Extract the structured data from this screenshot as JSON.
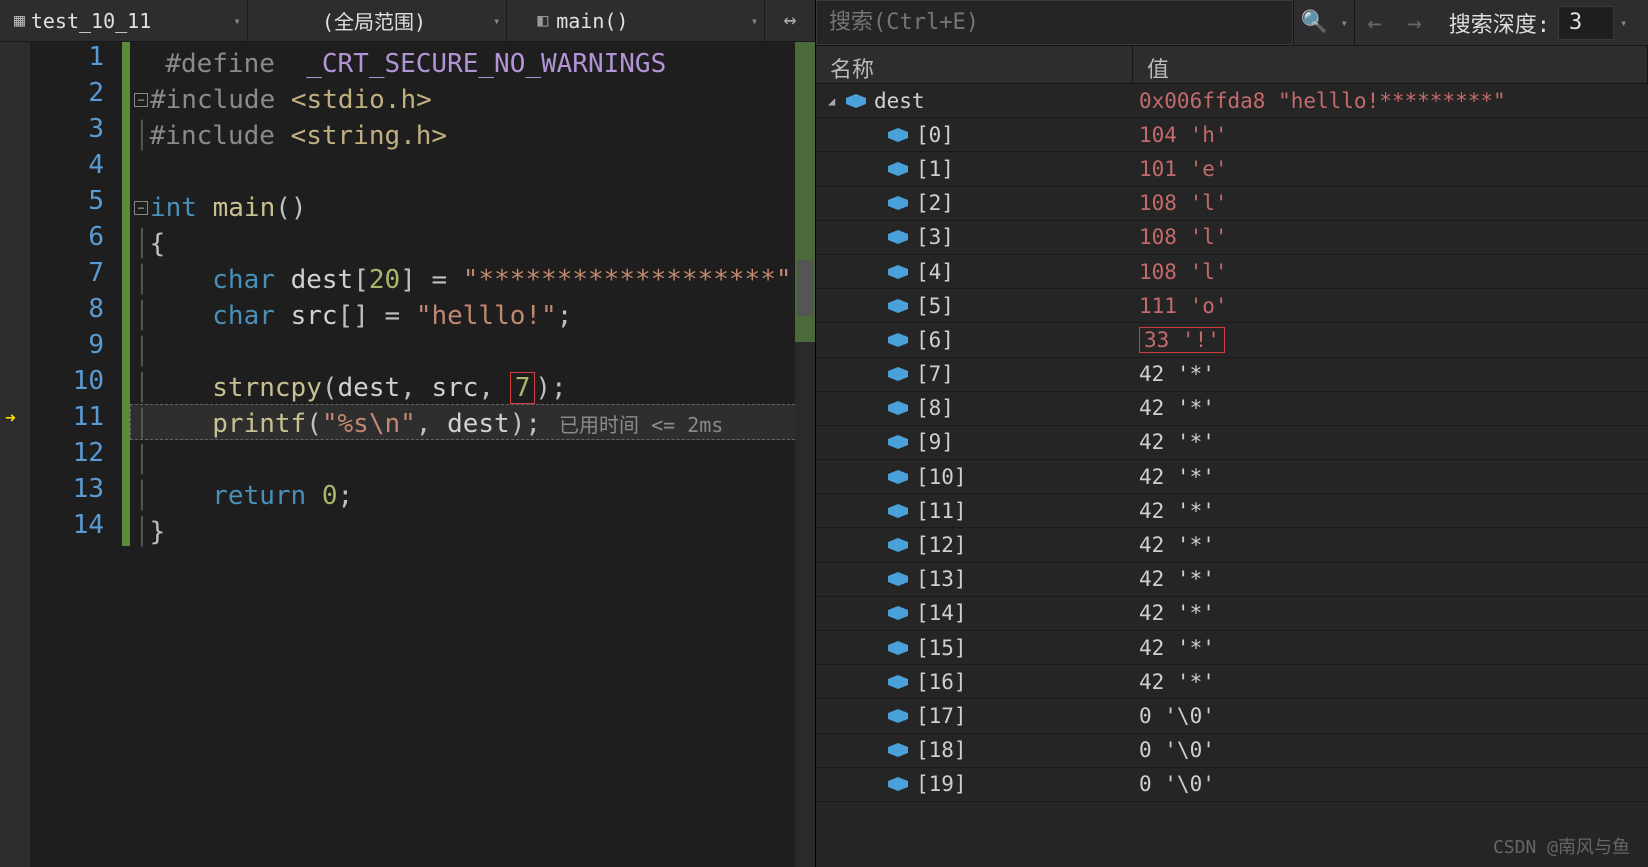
{
  "topbar": {
    "file": "test_10_11",
    "scope": "(全局范围)",
    "func": "main()"
  },
  "editor": {
    "lines": [
      "1",
      "2",
      "3",
      "4",
      "5",
      "6",
      "7",
      "8",
      "9",
      "10",
      "11",
      "12",
      "13",
      "14"
    ],
    "arrow_line": 11,
    "code": {
      "l1": {
        "pp": "#define",
        "mac": "_CRT_SECURE_NO_WARNINGS"
      },
      "l2": {
        "pp": "#include",
        "hdr": "<stdio.h>"
      },
      "l3": {
        "pp": "#include",
        "hdr": "<string.h>"
      },
      "l5": {
        "kw": "int",
        "fn": "main"
      },
      "l7": {
        "kw": "char",
        "id": "dest",
        "sz": "20",
        "str": "\"*******************\""
      },
      "l8": {
        "kw": "char",
        "id": "src",
        "str": "\"helllo!\""
      },
      "l10": {
        "fn": "strncpy",
        "a1": "dest",
        "a2": "src",
        "a3": "7"
      },
      "l11": {
        "fn": "printf",
        "fmt": "\"%s\\n\"",
        "arg": "dest",
        "hint": "已用时间 <= 2ms"
      },
      "l13": {
        "kw": "return",
        "val": "0"
      }
    }
  },
  "watch": {
    "search_placeholder": "搜索(Ctrl+E)",
    "depth_label": "搜索深度:",
    "depth_value": "3",
    "columns": {
      "name": "名称",
      "value": "值"
    },
    "root": {
      "name": "dest",
      "value": "0x006ffda8 \"helllo!*********\""
    },
    "highlight_index": 6,
    "items": [
      {
        "name": "[0]",
        "value": "104 'h'"
      },
      {
        "name": "[1]",
        "value": "101 'e'"
      },
      {
        "name": "[2]",
        "value": "108 'l'"
      },
      {
        "name": "[3]",
        "value": "108 'l'"
      },
      {
        "name": "[4]",
        "value": "108 'l'"
      },
      {
        "name": "[5]",
        "value": "111 'o'"
      },
      {
        "name": "[6]",
        "value": "33 '!'"
      },
      {
        "name": "[7]",
        "value": "42 '*'"
      },
      {
        "name": "[8]",
        "value": "42 '*'"
      },
      {
        "name": "[9]",
        "value": "42 '*'"
      },
      {
        "name": "[10]",
        "value": "42 '*'"
      },
      {
        "name": "[11]",
        "value": "42 '*'"
      },
      {
        "name": "[12]",
        "value": "42 '*'"
      },
      {
        "name": "[13]",
        "value": "42 '*'"
      },
      {
        "name": "[14]",
        "value": "42 '*'"
      },
      {
        "name": "[15]",
        "value": "42 '*'"
      },
      {
        "name": "[16]",
        "value": "42 '*'"
      },
      {
        "name": "[17]",
        "value": "0 '\\0'"
      },
      {
        "name": "[18]",
        "value": "0 '\\0'"
      },
      {
        "name": "[19]",
        "value": "0 '\\0'"
      }
    ]
  },
  "watermark": "CSDN @南风与鱼"
}
